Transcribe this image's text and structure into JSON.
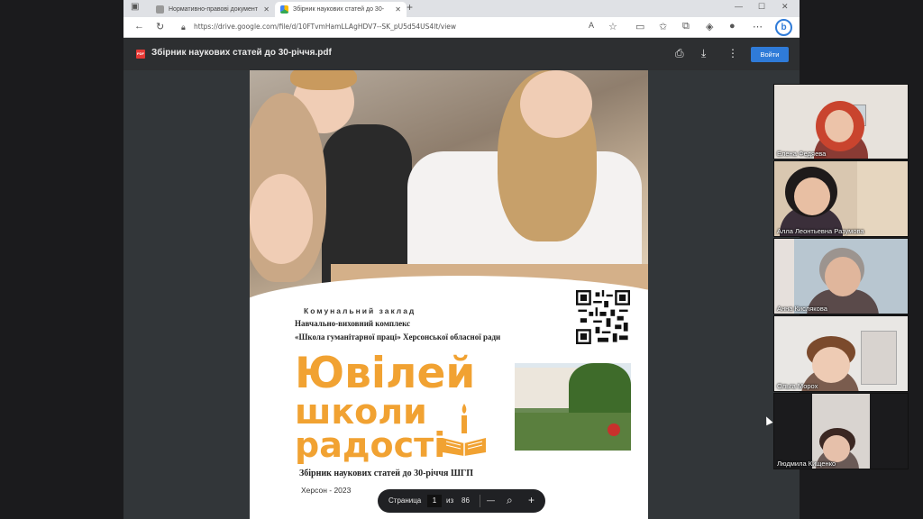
{
  "browser": {
    "tabs": [
      {
        "label": "Нормативно-правові документ",
        "active": false
      },
      {
        "label": "Збірник наукових статей до 30-",
        "active": true
      }
    ],
    "new_tab": "+",
    "url": "https://drive.google.com/file/d/10FTvmHamLLAgHDV7--SK_pU5d54US4lt/view",
    "profile_icon": "b"
  },
  "viewer": {
    "file_title": "Збірник наукових статей до 30-річчя.pdf",
    "pdf_badge": "PDF",
    "signin_label": "Войти"
  },
  "document": {
    "institution_line1": "Комунальний заклад",
    "institution_line2": "Навчально-виховний комплекс",
    "institution_line3": "«Школа гуманітарної праці» Херсонської обласної ради",
    "title_line1": "Ювілей",
    "title_line2": "школи",
    "title_line3": "радості",
    "subtitle": "Збірник наукових статей до 30-річчя ШГП",
    "city_year": "Херсон - 2023"
  },
  "pagenav": {
    "label": "Страница",
    "current": "1",
    "of": "из",
    "total": "86",
    "minus": "—",
    "plus": "+"
  },
  "participants": [
    {
      "name": "Елена Федяева"
    },
    {
      "name": "Алла Леонтьевна Разумова"
    },
    {
      "name": "Анна Кислякова"
    },
    {
      "name": "Ольга Морох"
    },
    {
      "name": "Людмила Кищенко"
    }
  ],
  "colors": {
    "accent_orange": "#f1a232",
    "signin_blue": "#2f7bd8"
  }
}
